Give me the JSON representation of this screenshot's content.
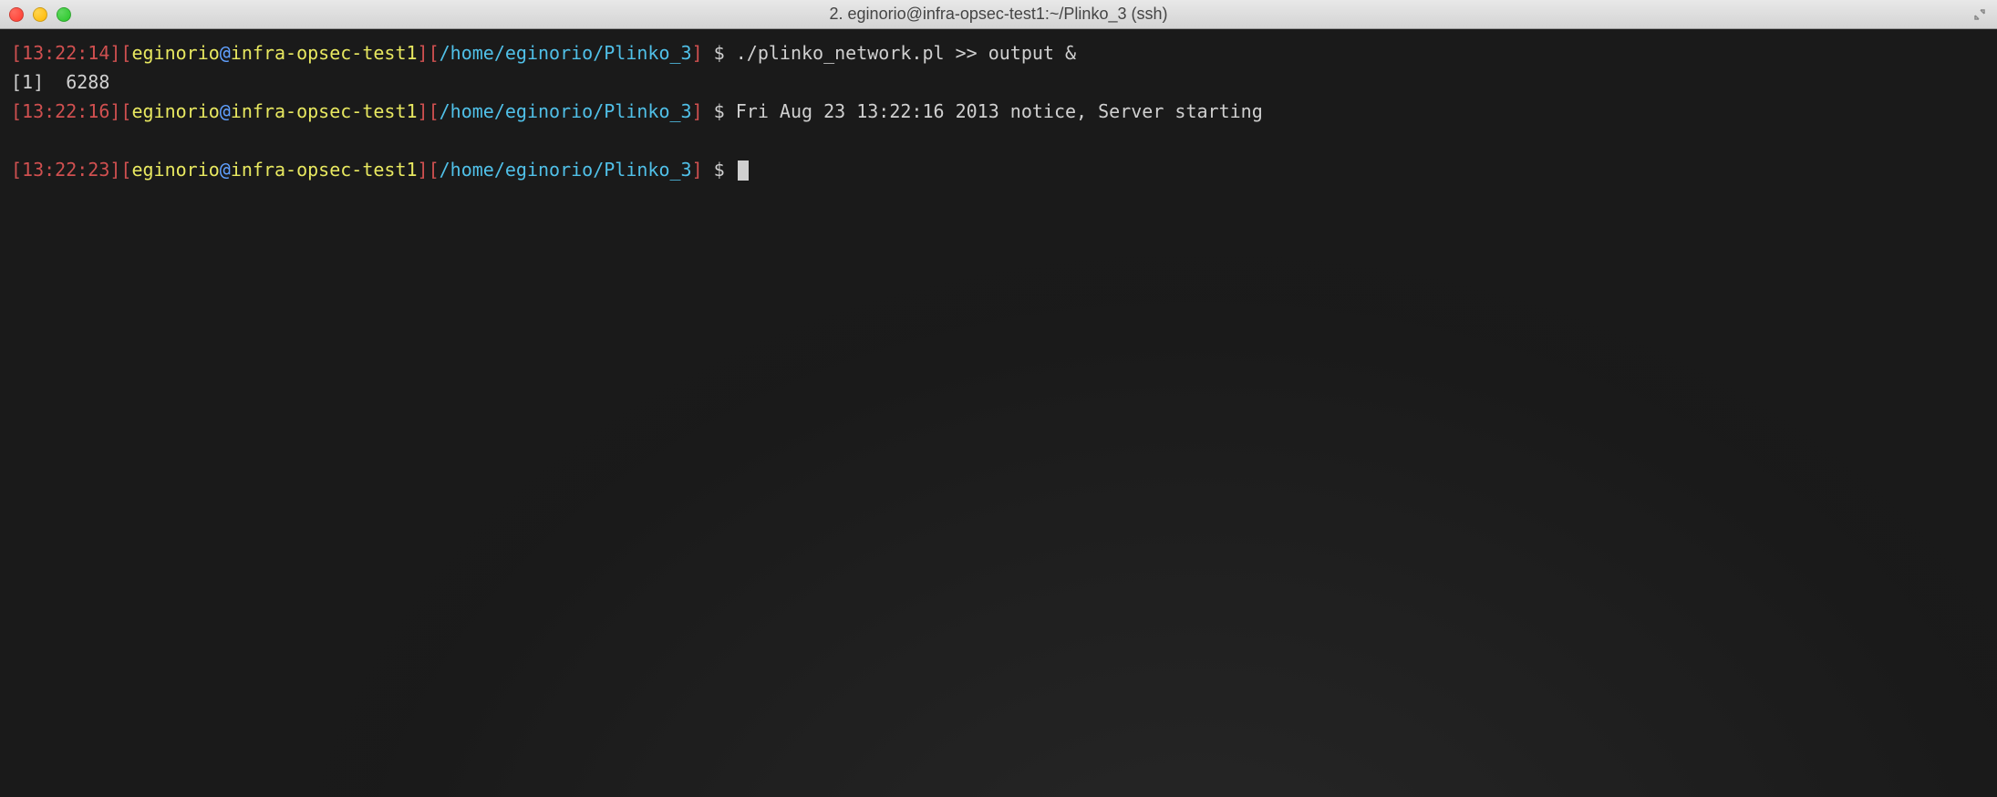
{
  "window": {
    "title": "2. eginorio@infra-opsec-test1:~/Plinko_3 (ssh)"
  },
  "lines": {
    "l1": {
      "lb1": "[",
      "ts": "13:22:14",
      "rb1": "]",
      "lb2": "[",
      "user": "eginorio",
      "at": "@",
      "host": "infra-opsec-test1",
      "rb2": "]",
      "lb3": "[",
      "path": "/home/eginorio/Plinko_3",
      "rb3": "]",
      "dollar": " $ ",
      "cmd": "./plinko_network.pl >> output &"
    },
    "l2": {
      "text": "[1]  6288"
    },
    "l3": {
      "lb1": "[",
      "ts": "13:22:16",
      "rb1": "]",
      "lb2": "[",
      "user": "eginorio",
      "at": "@",
      "host": "infra-opsec-test1",
      "rb2": "]",
      "lb3": "[",
      "path": "/home/eginorio/Plinko_3",
      "rb3": "]",
      "dollar": " $ ",
      "cmd": "Fri Aug 23 13:22:16 2013 notice, Server starting"
    },
    "l4": {
      "lb1": "[",
      "ts": "13:22:23",
      "rb1": "]",
      "lb2": "[",
      "user": "eginorio",
      "at": "@",
      "host": "infra-opsec-test1",
      "rb2": "]",
      "lb3": "[",
      "path": "/home/eginorio/Plinko_3",
      "rb3": "]",
      "dollar": " $ "
    }
  }
}
